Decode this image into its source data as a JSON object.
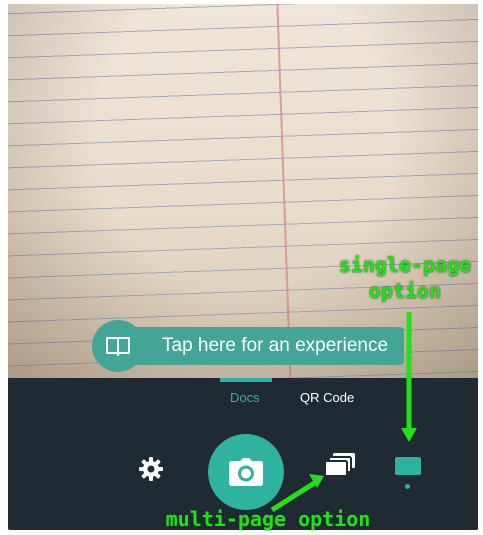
{
  "tooltip": {
    "text": "Tap here for an experience",
    "icon": "book-icon"
  },
  "tabs": [
    {
      "label": "Docs",
      "active": true
    },
    {
      "label": "QR Code",
      "active": false
    }
  ],
  "controls": {
    "settings_icon": "gear-icon",
    "shutter_icon": "camera-icon",
    "multi_page_icon": "stacked-pages-icon",
    "single_page_icon": "single-page-icon"
  },
  "annotations": {
    "single_page_line1": "single-page",
    "single_page_line2": "option",
    "multi_page": "multi-page option"
  },
  "colors": {
    "accent": "#2fb3a0",
    "tooltip": "#43a596",
    "bar": "#1f2a33",
    "annotation": "#22e01a"
  }
}
